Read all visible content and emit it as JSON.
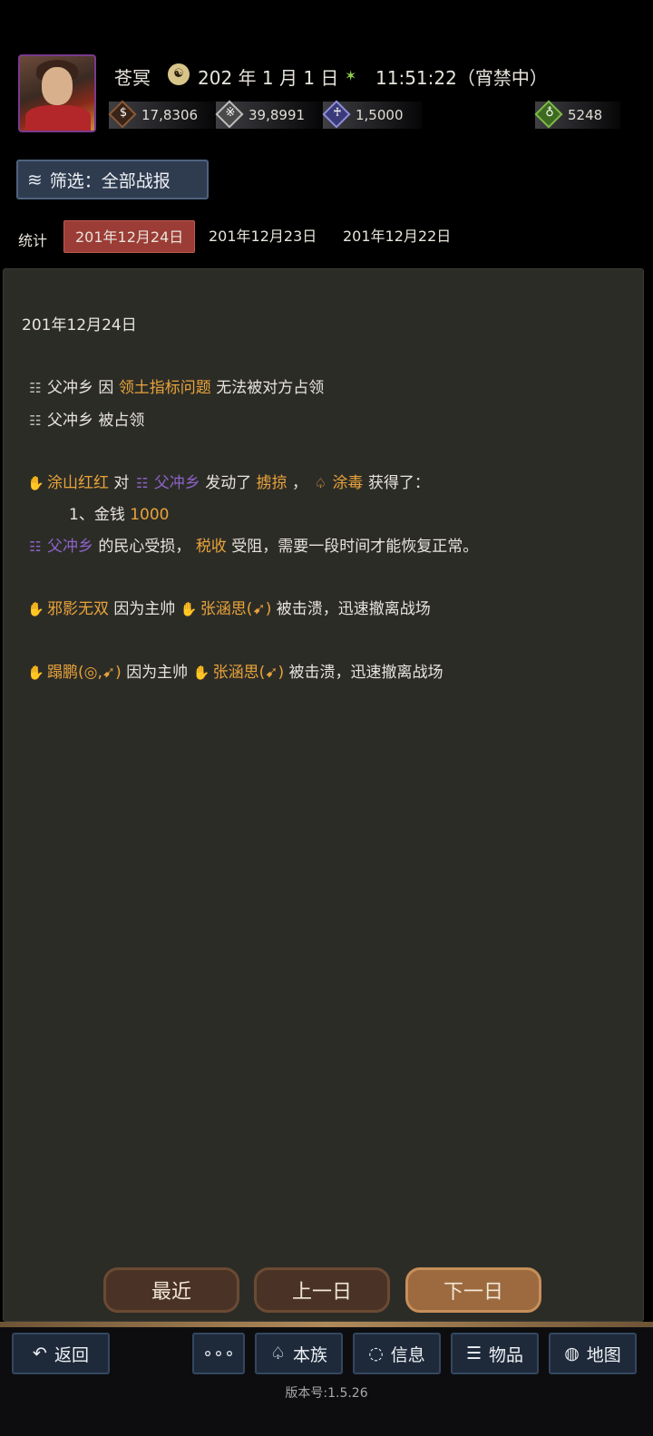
{
  "header": {
    "name": "苍冥",
    "date": "202 年 1 月 1 日",
    "time": "11:51:22（宵禁中）",
    "resources": [
      {
        "icon": "coin-icon",
        "value": "17,8306"
      },
      {
        "icon": "grain-icon",
        "value": "39,8991"
      },
      {
        "icon": "soldier-icon",
        "value": "1,5000"
      },
      {
        "icon": "money-bag-icon",
        "value": "5248"
      }
    ]
  },
  "filter": {
    "label": "筛选：全部战报"
  },
  "tabs": {
    "stat": "统计",
    "dates": [
      "201年12月24日",
      "201年12月23日",
      "201年12月22日"
    ]
  },
  "report": {
    "date": "201年12月24日",
    "l1": {
      "place": "父冲乡",
      "a": "因",
      "reason": "领土指标问题",
      "b": "无法被对方占领"
    },
    "l2": {
      "place": "父冲乡",
      "a": "被占领"
    },
    "l3": {
      "who": "涂山红红",
      "a": "对",
      "place": "父冲乡",
      "b": "发动了",
      "action": "掳掠",
      "c": "，",
      "clan": "涂毒",
      "d": "获得了："
    },
    "l4": {
      "a": "1、金钱",
      "amount": "1000"
    },
    "l5": {
      "place": "父冲乡",
      "a": "的民心受损，",
      "tax": "税收",
      "b": "受阻，需要一段时间才能恢复正常。"
    },
    "l6": {
      "who": "邪影无双",
      "a": "因为主帅",
      "leader": "张涵思(",
      "leader_end": ")",
      "b": "被击溃，迅速撤离战场"
    },
    "l7": {
      "who": "蹋鹏(",
      "who_mid": ",",
      "who_end": ")",
      "a": "因为主帅",
      "leader": "张涵思(",
      "leader_end": ")",
      "b": "被击溃，迅速撤离战场"
    }
  },
  "nav": {
    "recent": "最近",
    "prev": "上一日",
    "next": "下一日"
  },
  "bottom": {
    "back": "返回",
    "more": "∘∘∘",
    "clan": "本族",
    "info": "信息",
    "items": "物品",
    "map": "地图",
    "version": "版本号:1.5.26"
  }
}
